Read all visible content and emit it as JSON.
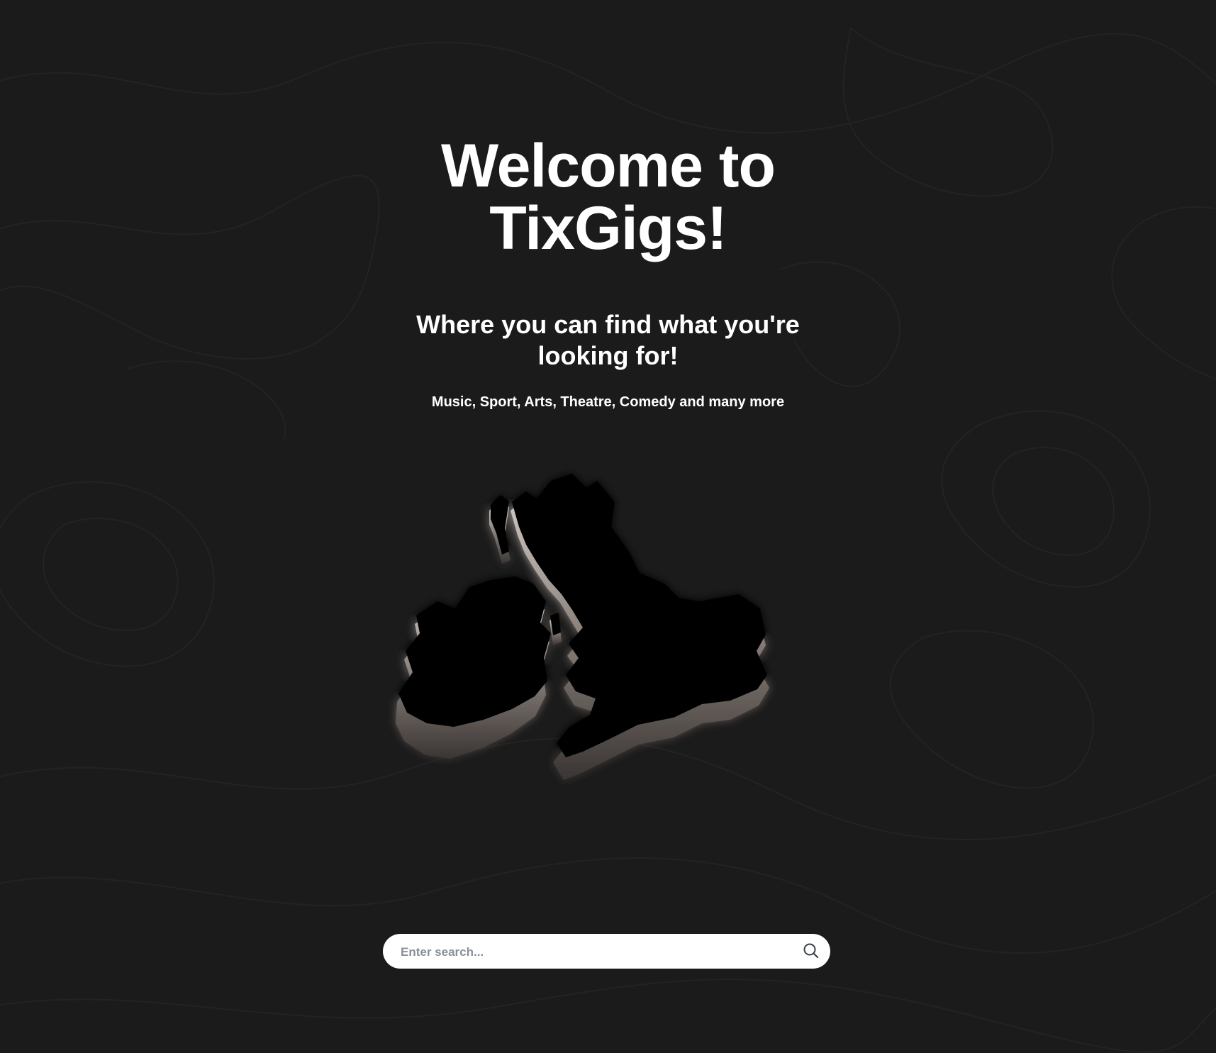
{
  "hero": {
    "title": "Welcome to TixGigs!",
    "subtitle": "Where you can find what you're looking for!",
    "tagline": "Music, Sport, Arts, Theatre, Comedy and many more"
  },
  "search": {
    "placeholder": "Enter search...",
    "value": ""
  },
  "map": {
    "label": "uk-ireland-3d-map"
  },
  "colors": {
    "background": "#1b1b1b",
    "text": "#ffffff",
    "search_bg": "#ffffff",
    "placeholder": "#8a8f99",
    "icon": "#3a3f4a"
  }
}
